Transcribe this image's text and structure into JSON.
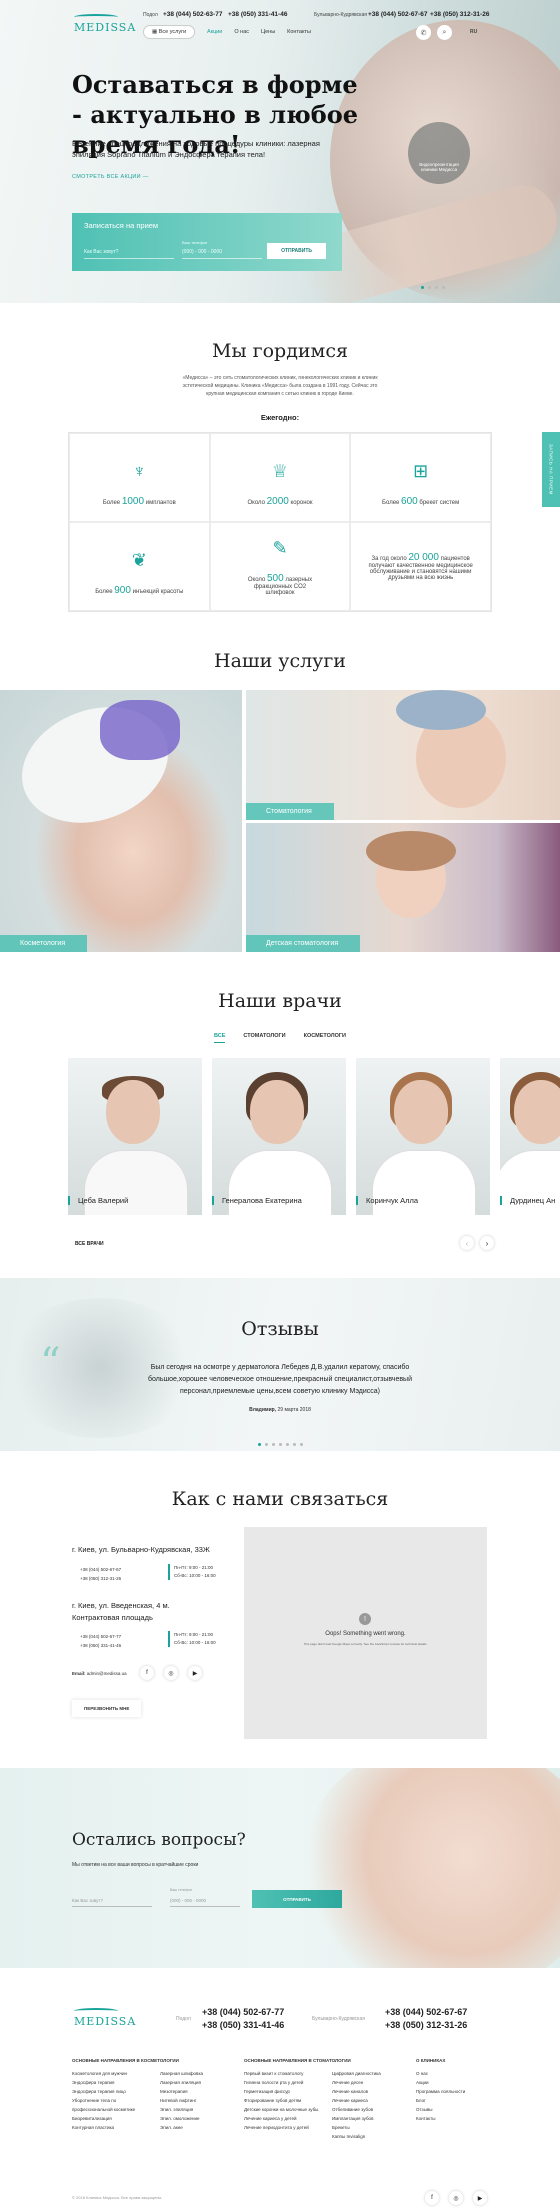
{
  "header": {
    "logo": "MEDISSA",
    "city1": "Подол",
    "phone1a": "+38 (044) 502-63-77",
    "phone1b": "+38 (050) 331-41-46",
    "city2": "Бульварно-Кудрявская",
    "phone2a": "+38 (044) 502-67-67",
    "phone2b": "+38 (050) 312-31-26",
    "all_services": "Все услуги",
    "menu": [
      "Акции",
      "О нас",
      "Цены",
      "Контакты"
    ],
    "lang": "RU"
  },
  "hero": {
    "title": "Оставаться в форме - актуально в любое время года!",
    "subtitle": "Весенние спецпредложения на ходовые процедуры клиники: лазерная эпиляция Soprano Titanium и Эндосфера терапия тела!",
    "more_link": "СМОТРЕТЬ ВСЕ АКЦИИ —",
    "promo_circle": "Видеопрезентация клиники Медисса",
    "form": {
      "title": "Записаться на прием",
      "name_placeholder": "Как Вас зовут?",
      "phone_label": "Ваш телефон",
      "phone_placeholder": "(000) - 000 - 0000",
      "submit": "ОТПРАВИТЬ"
    }
  },
  "side_tab": "ЗАПИСЬ НА ПРИЕМ",
  "proud": {
    "title": "Мы гордимся",
    "text": "«Медисса» – это сеть стоматологических клиник, гинекологических клиник и клиник эстетической медицины. Клиника «Медисса» была создана в 1991 году. Сейчас это крупная медицинская компания с сетью клиник в городе Киеве.",
    "yearly": "Ежегодно:",
    "stats": [
      {
        "pre": "Более",
        "num": "1000",
        "post": "имплантов",
        "icon": "implant-icon"
      },
      {
        "pre": "Около",
        "num": "2000",
        "post": "коронок",
        "icon": "crown-icon"
      },
      {
        "pre": "Более",
        "num": "600",
        "post": "брекет систем",
        "icon": "braces-icon"
      },
      {
        "pre": "Более",
        "num": "900",
        "post": "инъекций красоты",
        "icon": "lips-icon"
      },
      {
        "pre": "Около",
        "num": "500",
        "post": "лазерных фракционных CO2 шлифовок",
        "icon": "laser-icon"
      },
      {
        "pre": "За год около",
        "num": "20 000",
        "post": "пациентов получают качественное медицинское обслуживание и становятся нашими друзьями на всю жизнь",
        "icon": ""
      }
    ]
  },
  "services": {
    "title": "Наши услуги",
    "items": [
      "Косметология",
      "Стоматология",
      "Детская стоматология"
    ]
  },
  "doctors": {
    "title": "Наши врачи",
    "tabs": [
      "ВСЕ",
      "СТОМАТОЛОГИ",
      "КОСМЕТОЛОГИ"
    ],
    "list": [
      "Цеба Валерий",
      "Генералова Екатерина",
      "Коринчук Алла",
      "Дурдинец Ан"
    ],
    "all_link": "ВСЕ ВРАЧИ"
  },
  "reviews": {
    "title": "Отзывы",
    "text": "Был сегодня на осмотре у дерматолога Лебедев Д.В.удалил кератому, спасибо большое,хорошее человеческое отношение,прекрасный специалист,отзывчевый персонал,приемлемые цены,всем советую клинику Мэдисса)",
    "author": "Владимир,",
    "date": "29 марта 2018"
  },
  "contacts": {
    "title": "Как с нами связаться",
    "addr1": "г. Киев, ул. Бульварно-Кудрявская, 33Ж",
    "addr1_phones": [
      "+38 (044) 502-67-67",
      "+38 (050) 312-31-26"
    ],
    "addr1_sched": [
      "Пн-Пт: 9:00 - 21:00",
      "Сб-Вс: 10:00 - 16:00"
    ],
    "addr2": "г. Киев, ул. Введенская, 4 м. Контрактовая площадь",
    "addr2_phones": [
      "+38 (044) 502-67-77",
      "+38 (050) 331-41-46"
    ],
    "addr2_sched": [
      "Пн-Пт: 9:00 - 21:00",
      "Сб-Вс: 10:00 - 16:00"
    ],
    "email_label": "Email:",
    "email": "admin@medissa.ua",
    "callback": "ПЕРЕЗВОНИТЬ МНЕ",
    "map_error": "Oops! Something went wrong.",
    "map_error_sub": "This page didn't load Google Maps correctly. See the JavaScript console for technical details."
  },
  "ask": {
    "title": "Остались вопросы?",
    "sub": "Мы ответим на все ваши вопросы в кратчайшие сроки",
    "name_placeholder": "Как Вас зовут?",
    "phone_label": "Ваш телефон",
    "phone_placeholder": "(000) - 000 - 0000",
    "submit": "ОТПРАВИТЬ"
  },
  "footer": {
    "logo": "MEDISSA",
    "city1": "Подол",
    "phone1a": "+38 (044) 502-67-77",
    "phone1b": "+38 (050) 331-41-46",
    "city2": "Бульварно-Кудрявская",
    "phone2a": "+38 (044) 502-67-67",
    "phone2b": "+38 (050) 312-31-26",
    "col1_title": "ОСНОВНЫЕ НАПРАВЛЕНИЯ В КОСМЕТОЛОГИИ",
    "col1a": [
      "Косметология для мужчин",
      "Эндосфера терапия",
      "Эндосфера терапия лицо",
      "Уборотнение тела по профессиональной косметике",
      "Биоревитализация",
      "Контурная пластика"
    ],
    "col1b": [
      "Лазерная шлифовка",
      "Лазерная эпиляция",
      "Мезотерапия",
      "Нитевой лифтинг",
      "Эпил. эпиляция",
      "Эпил. омоложение",
      "Эпил. акне"
    ],
    "col2_title": "ОСНОВНЫЕ НАПРАВЛЕНИЯ В СТОМАТОЛОГИИ",
    "col2a": [
      "Первый визит к стоматологу",
      "Гигиена полости рта у детей",
      "Герметизация фиссур",
      "Фторирование зубов детям",
      "Детские коронки на молочные зубы",
      "Лечение кариеса у детей",
      "Лечение периодонтита у детей"
    ],
    "col2b": [
      "Цифровая диагностика",
      "Лечение десен",
      "Лечение каналов",
      "Лечение кариеса",
      "Отбеливание зубов",
      "Имплантация зубов",
      "Брекеты",
      "Каппы Invisalign"
    ],
    "col3_title": "О КЛИНИКАХ",
    "col3": [
      "О нас",
      "Акции",
      "Программа лояльности",
      "Блог",
      "Отзывы",
      "Контакты"
    ],
    "copyright": "© 2018 Клиника Медисса. Все права защищены."
  },
  "colors": {
    "accent": "#1aa39a",
    "accent_light": "#4fc1b4"
  }
}
